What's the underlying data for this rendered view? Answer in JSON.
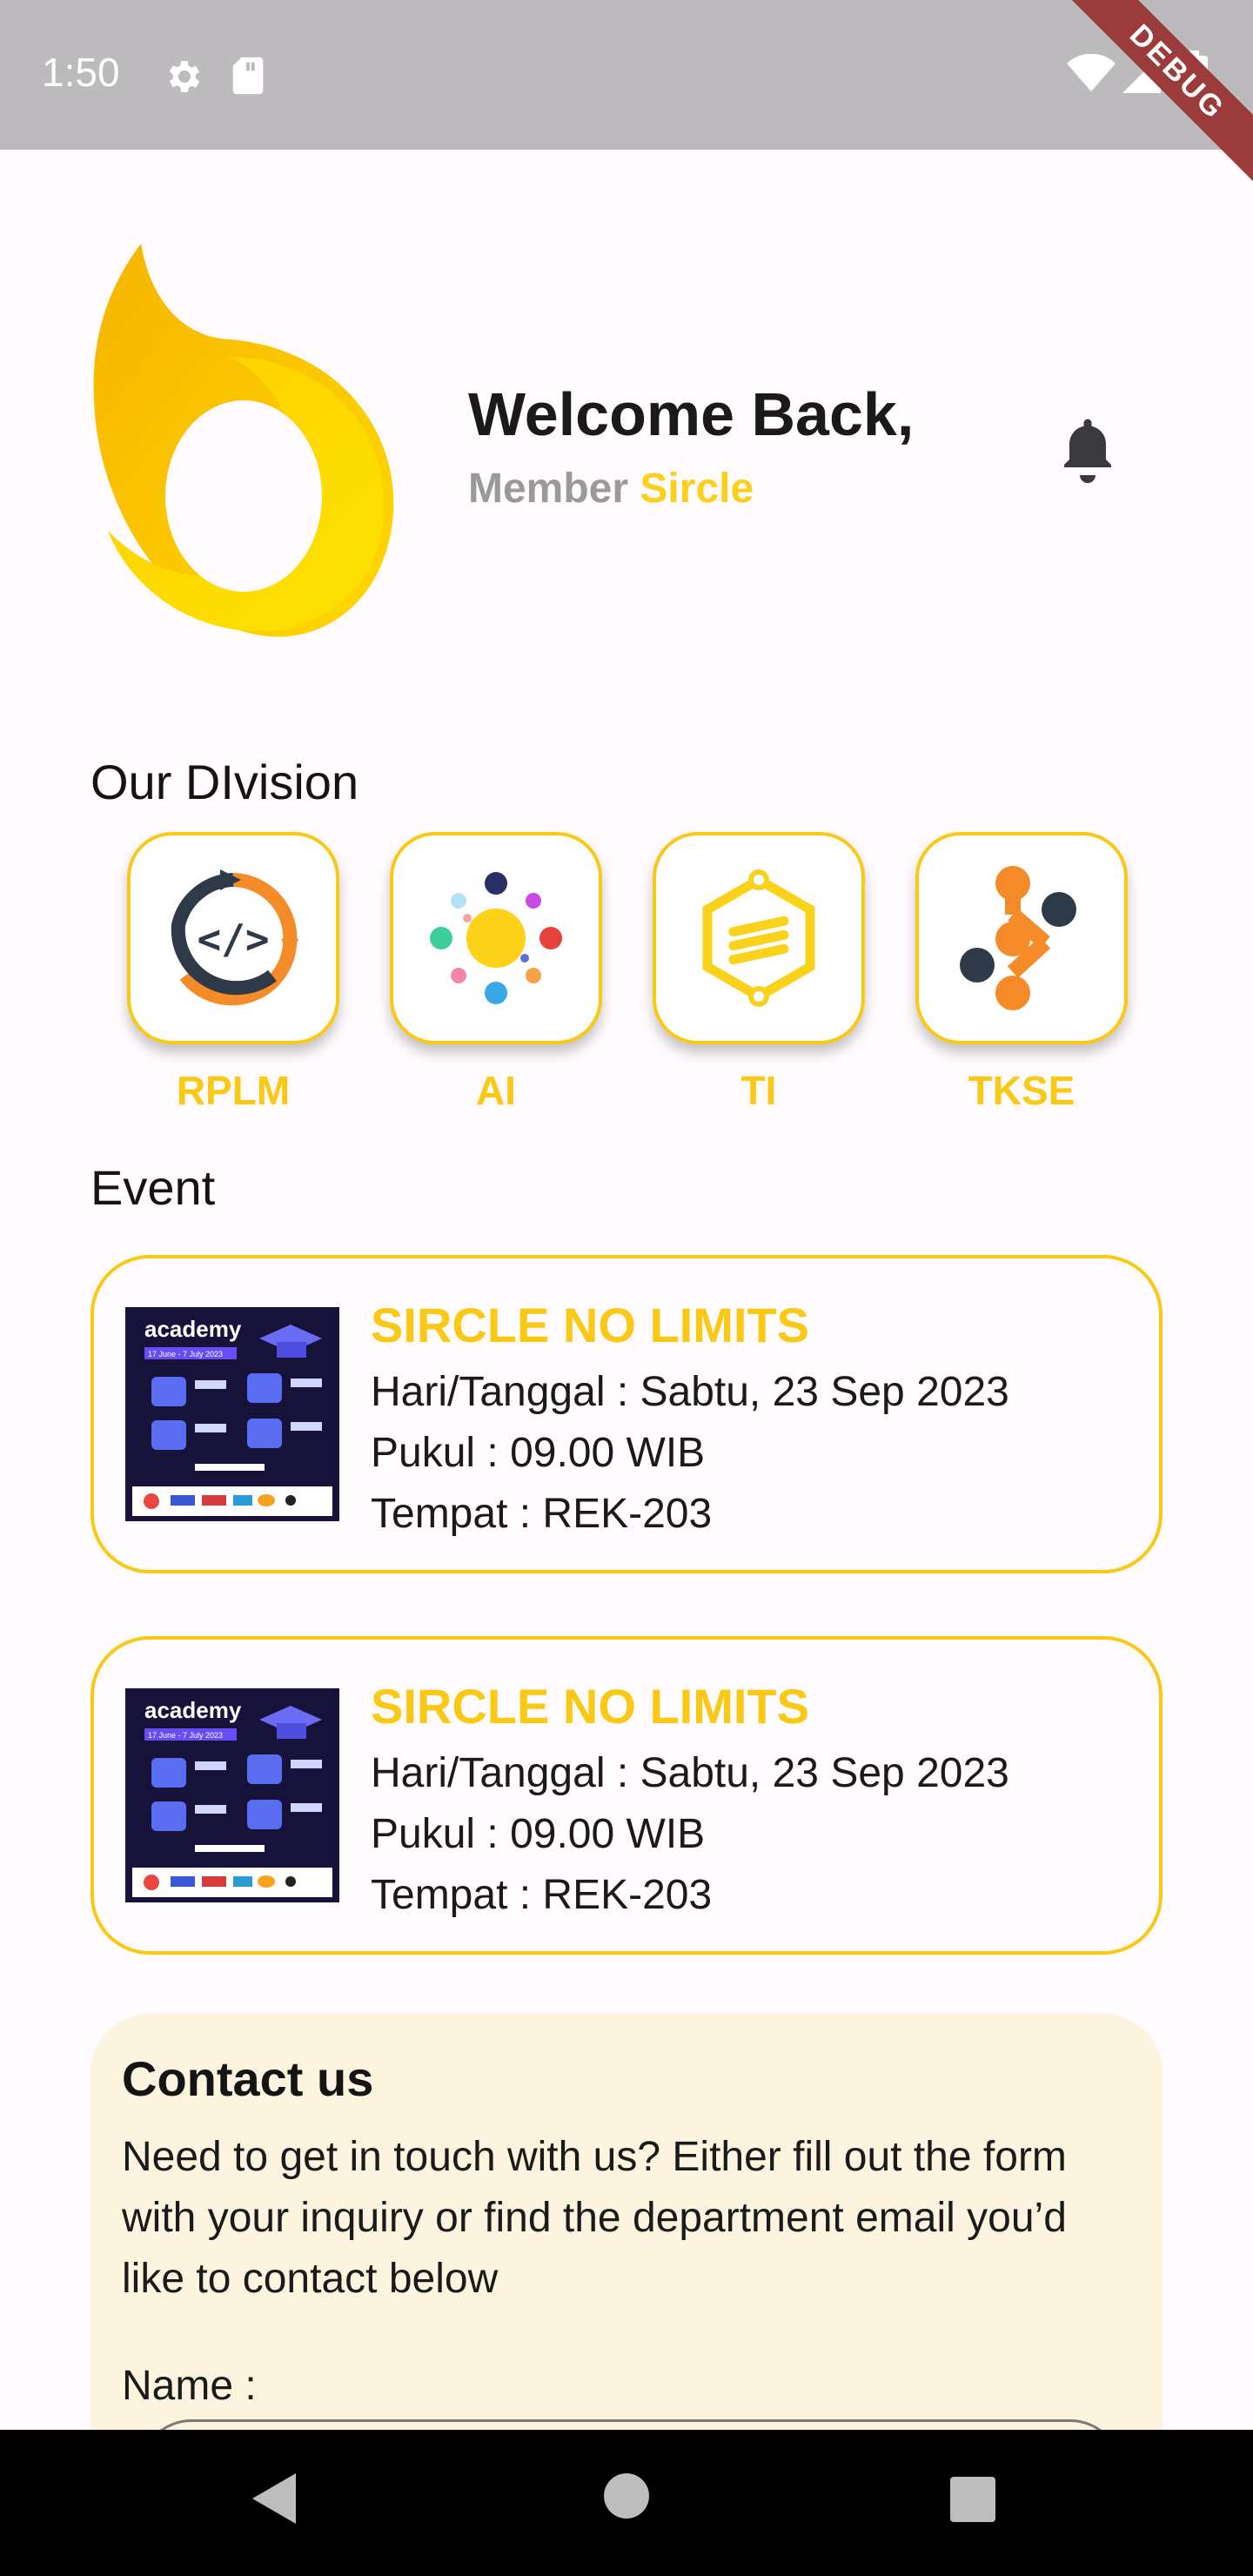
{
  "status_bar": {
    "time": "1:50",
    "debug_label": "DEBUG",
    "icons": [
      "settings-icon",
      "sd-card-icon",
      "wifi-icon",
      "signal-icon",
      "battery-icon"
    ]
  },
  "header": {
    "welcome": "Welcome Back,",
    "member": "Member",
    "brand": "Sircle",
    "icons": [
      "sircle-logo",
      "bell-icon"
    ]
  },
  "division": {
    "title": "Our DIvision",
    "items": [
      {
        "label": "RPLM",
        "icon": "code-cycle-icon"
      },
      {
        "label": "AI",
        "icon": "ai-network-icon"
      },
      {
        "label": "TI",
        "icon": "hexagon-chip-icon"
      },
      {
        "label": "TKSE",
        "icon": "node-share-icon"
      }
    ]
  },
  "event": {
    "title": "Event",
    "items": [
      {
        "title": "SIRCLE NO LIMITS",
        "date": "Hari/Tanggal : Sabtu, 23 Sep 2023",
        "time": "Pukul : 09.00 WIB",
        "place": "Tempat : REK-203",
        "thumb_title": "academy",
        "thumb_dates": "17 June - 7 July 2023"
      },
      {
        "title": "SIRCLE NO LIMITS",
        "date": "Hari/Tanggal : Sabtu, 23 Sep 2023",
        "time": "Pukul : 09.00 WIB",
        "place": "Tempat : REK-203",
        "thumb_title": "academy",
        "thumb_dates": "17 June - 7 July 2023"
      }
    ]
  },
  "contact": {
    "title": "Contact us",
    "text": "Need to get in touch with us? Either fill out the form with your inquiry or find the department email you’d like to contact below",
    "name_label": "Name :",
    "name_value": ""
  },
  "nav": {
    "icons": [
      "back-icon",
      "home-icon",
      "recents-icon"
    ]
  },
  "colors": {
    "accent": "#f9c915",
    "background": "#fffbfe",
    "contact_bg": "#fdf4e0",
    "status_bar": "#bcbabd"
  }
}
